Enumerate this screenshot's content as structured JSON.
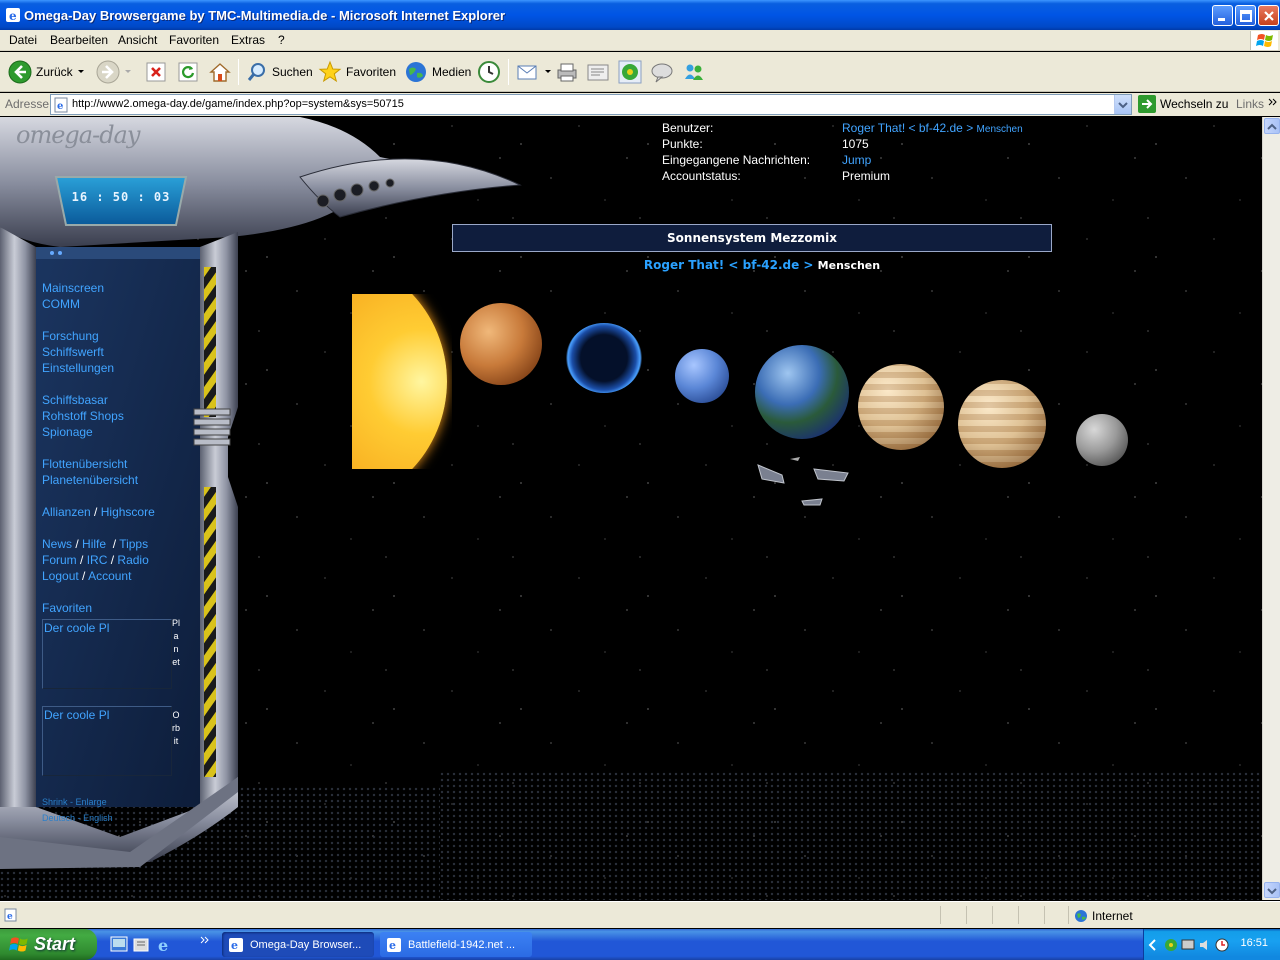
{
  "window": {
    "title": "Omega-Day Browsergame by TMC-Multimedia.de - Microsoft Internet Explorer"
  },
  "menu": [
    "Datei",
    "Bearbeiten",
    "Ansicht",
    "Favoriten",
    "Extras",
    "?"
  ],
  "toolbar": {
    "back": "Zurück",
    "search": "Suchen",
    "favorites": "Favoriten",
    "media": "Medien"
  },
  "address": {
    "label": "Adresse",
    "url": "http://www2.omega-day.de/game/index.php?op=system&sys=50715",
    "go": "Wechseln zu",
    "links": "Links"
  },
  "game": {
    "logo": "omega-day",
    "clock": "16 : 50 : 03",
    "nav": {
      "mainscreen": "Mainscreen",
      "comm": "COMM",
      "forschung": "Forschung",
      "schiffswerft": "Schiffswerft",
      "einstellungen": "Einstellungen",
      "schiffsbasar": "Schiffsbasar",
      "rohstoff": "Rohstoff Shops",
      "spionage": "Spionage",
      "flotten": "Flottenübersicht",
      "planeten": "Planetenübersicht",
      "allianzen": "Allianzen",
      "highscore": "Highscore",
      "news": "News",
      "hilfe": "Hilfe",
      "tipps": "Tipps",
      "forum": "Forum",
      "irc": "IRC",
      "radio": "Radio",
      "logout": "Logout",
      "account": "Account",
      "favoriten": "Favoriten",
      "shrink": "Shrink",
      "enlarge": "Enlarge",
      "deutsch": "Deutsch",
      "english": "English",
      "slash": "/",
      "dash": "-"
    },
    "favorites": [
      {
        "name": "Der coole Pl",
        "type": "Planet"
      },
      {
        "name": "Der coole Pl",
        "type": "Orbit"
      }
    ],
    "info": {
      "user_label": "Benutzer:",
      "user_value": "Roger That! < bf-42.de >",
      "user_race": "Menschen",
      "points_label": "Punkte:",
      "points_value": "1075",
      "messages_label": "Eingegangene Nachrichten:",
      "messages_value": "Jump",
      "status_label": "Accountstatus:",
      "status_value": "Premium"
    },
    "system_title": "Sonnensystem Mezzomix",
    "owner": {
      "name": "Roger That!  < bf-42.de >",
      "race": "Menschen"
    },
    "planet_colors": {
      "sun": "#f5a31a",
      "venus": "#c87a3a",
      "dark": "#1b4ea8",
      "neptune": "#5a86d6",
      "earth": "#3b6db5",
      "jupiter": "#d9b98a",
      "moon": "#9a9a9a"
    }
  },
  "statusbar": {
    "zone": "Internet"
  },
  "taskbar": {
    "start": "Start",
    "tasks": [
      "Omega-Day Browser...",
      "Battlefield-1942.net ..."
    ],
    "time": "16:51"
  }
}
